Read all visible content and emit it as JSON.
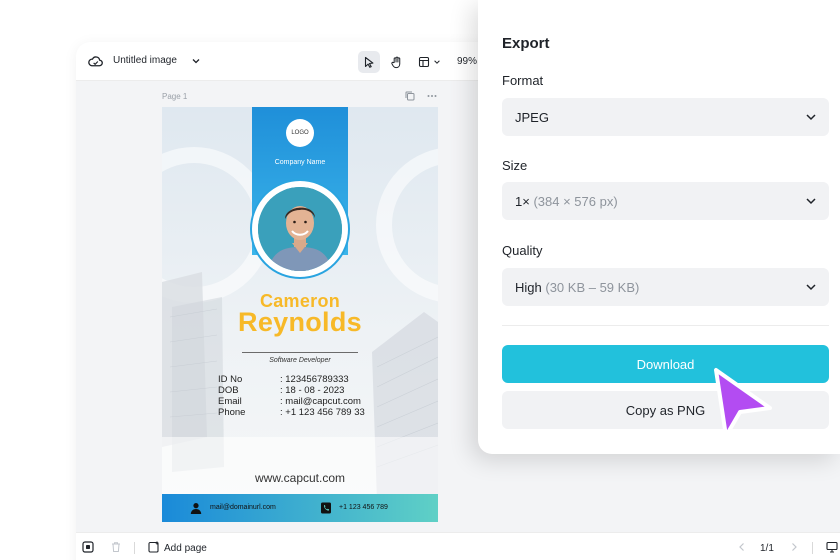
{
  "editor": {
    "title": "Untitled image",
    "zoom": "99%",
    "page_label": "Page 1"
  },
  "card": {
    "logo": "LOGO",
    "company": "Company Name",
    "first_name": "Cameron",
    "last_name": "Reynolds",
    "role": "Software Developer",
    "fields": [
      {
        "label": "ID No",
        "value": ": 123456789333"
      },
      {
        "label": "DOB",
        "value": ": 18 - 08 - 2023"
      },
      {
        "label": "Email",
        "value": ": mail@capcut.com"
      },
      {
        "label": "Phone",
        "value": ": +1 123 456 789 33"
      }
    ],
    "website": "www.capcut.com",
    "footer_email": "mail@domainurl.com",
    "footer_phone": "+1 123 456 789"
  },
  "bottom": {
    "add_page": "Add page",
    "pagination": "1/1"
  },
  "export": {
    "title": "Export",
    "format_label": "Format",
    "format_value": "JPEG",
    "size_label": "Size",
    "size_value": "1×",
    "size_detail": "(384 × 576 px)",
    "quality_label": "Quality",
    "quality_value": "High",
    "quality_detail": "(30 KB – 59 KB)",
    "download_label": "Download",
    "copy_label": "Copy as PNG"
  },
  "colors": {
    "accent": "#22c1dc",
    "name_yellow": "#f7b928",
    "cursor": "#b34cf2"
  }
}
